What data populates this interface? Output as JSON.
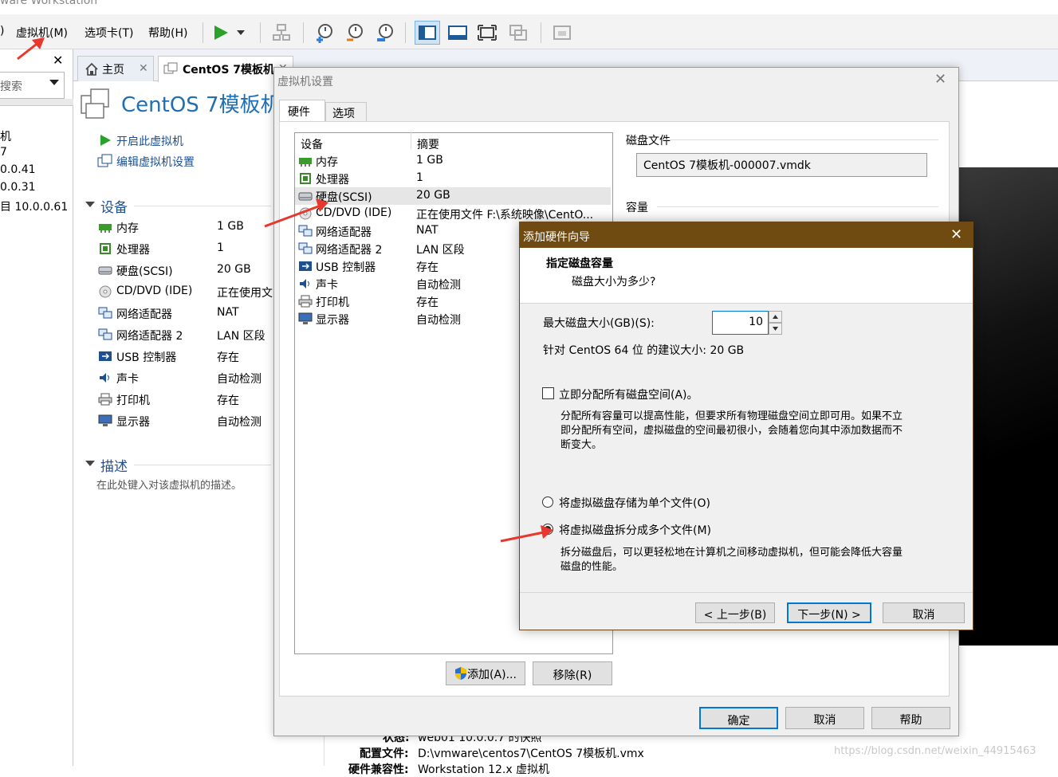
{
  "app": {
    "title": "ware Workstation"
  },
  "menu": {
    "vm": "虚拟机(M)",
    "tabs": "选项卡(T)",
    "help": "帮助(H)"
  },
  "library": {
    "search_placeholder": "搜索",
    "items": [
      "机",
      "7",
      "0.0.41",
      "0.0.31",
      "目 10.0.0.61"
    ]
  },
  "tabs": {
    "home": "主页",
    "vm": "CentOS 7模板机"
  },
  "summary": {
    "vm_title": "CentOS 7模板机",
    "actions": {
      "power_on": "开启此虚拟机",
      "edit": "编辑虚拟机设置"
    },
    "devices_header": "设备",
    "devices": [
      {
        "name": "内存",
        "value": "1 GB",
        "icon": "memory-icon"
      },
      {
        "name": "处理器",
        "value": "1",
        "icon": "cpu-icon"
      },
      {
        "name": "硬盘(SCSI)",
        "value": "20 GB",
        "icon": "hard-disk-icon"
      },
      {
        "name": "CD/DVD (IDE)",
        "value": "正在使用文",
        "icon": "cd-icon"
      },
      {
        "name": "网络适配器",
        "value": "NAT",
        "icon": "network-icon"
      },
      {
        "name": "网络适配器 2",
        "value": "LAN 区段",
        "icon": "network-icon"
      },
      {
        "name": "USB 控制器",
        "value": "存在",
        "icon": "usb-icon"
      },
      {
        "name": "声卡",
        "value": "自动检测",
        "icon": "sound-icon"
      },
      {
        "name": "打印机",
        "value": "存在",
        "icon": "printer-icon"
      },
      {
        "name": "显示器",
        "value": "自动检测",
        "icon": "display-icon"
      }
    ],
    "desc_header": "描述",
    "desc_placeholder": "在此处键入对该虚拟机的描述。",
    "bottom": {
      "state_label": "状态:",
      "state_value": "web01 10.0.0.7 的快照",
      "config_label": "配置文件:",
      "config_value": "D:\\vmware\\centos7\\CentOS 7模板机.vmx",
      "compat_label": "硬件兼容性:",
      "compat_value": "Workstation 12.x 虚拟机"
    }
  },
  "settings": {
    "title": "虚拟机设置",
    "tabs": [
      "硬件",
      "选项"
    ],
    "col_device": "设备",
    "col_summary": "摘要",
    "rows": [
      {
        "name": "内存",
        "value": "1 GB"
      },
      {
        "name": "处理器",
        "value": "1"
      },
      {
        "name": "硬盘(SCSI)",
        "value": "20 GB"
      },
      {
        "name": "CD/DVD (IDE)",
        "value": "正在使用文件 F:\\系统映像\\CentO..."
      },
      {
        "name": "网络适配器",
        "value": "NAT"
      },
      {
        "name": "网络适配器 2",
        "value": "LAN 区段"
      },
      {
        "name": "USB 控制器",
        "value": "存在"
      },
      {
        "name": "声卡",
        "value": "自动检测"
      },
      {
        "name": "打印机",
        "value": "存在"
      },
      {
        "name": "显示器",
        "value": "自动检测"
      }
    ],
    "disk_file_label": "磁盘文件",
    "disk_file_value": "CentOS 7模板机-000007.vmdk",
    "capacity_label": "容量",
    "add_button": "添加(A)...",
    "remove_button": "移除(R)",
    "ok": "确定",
    "cancel": "取消",
    "help": "帮助"
  },
  "wizard": {
    "title": "添加硬件向导",
    "heading": "指定磁盘容量",
    "subheading": "磁盘大小为多少?",
    "max_size_label": "最大磁盘大小(GB)(S):",
    "max_size_value": "10",
    "recommend": "针对 CentOS 64 位 的建议大小: 20 GB",
    "allocate_label": "立即分配所有磁盘空间(A)。",
    "allocate_desc_1": "分配所有容量可以提高性能，但要求所有物理磁盘空间立即可用。如果不立",
    "allocate_desc_2": "即分配所有空间，虚拟磁盘的空间最初很小，会随着您向其中添加数据而不",
    "allocate_desc_3": "断变大。",
    "single_label": "将虚拟磁盘存储为单个文件(O)",
    "split_label": "将虚拟磁盘拆分成多个文件(M)",
    "split_desc_1": "拆分磁盘后，可以更轻松地在计算机之间移动虚拟机，但可能会降低大容量",
    "split_desc_2": "磁盘的性能。",
    "selected": "split",
    "back": "< 上一步(B)",
    "next": "下一步(N) >",
    "cancel": "取消"
  },
  "watermark": "https://blog.csdn.net/weixin_44915463",
  "colors": {
    "accent_blue": "#1f6fb3",
    "wizard_title": "#6f4a11",
    "annotation_red": "#e8372c"
  }
}
